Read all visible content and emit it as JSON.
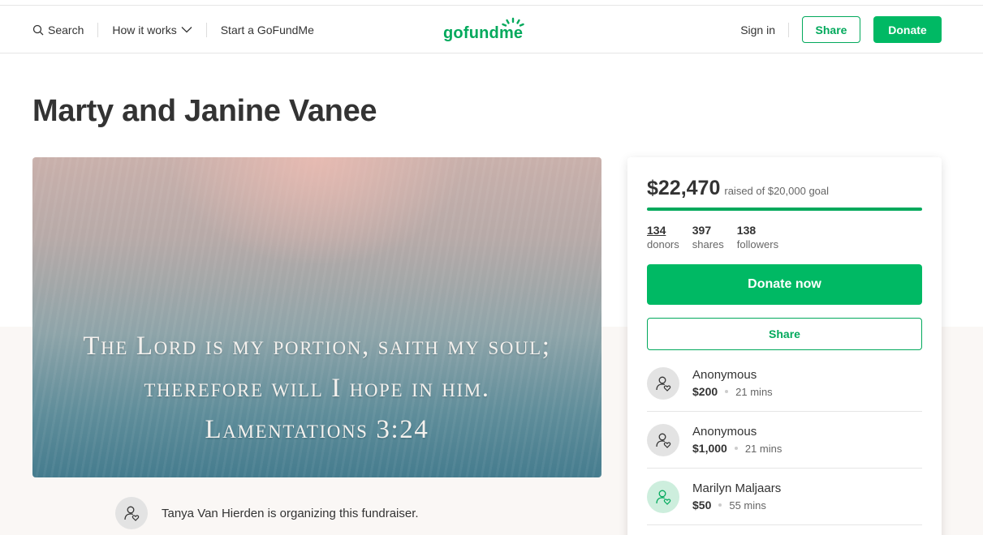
{
  "header": {
    "search_label": "Search",
    "how_it_works_label": "How it works",
    "start_label": "Start a GoFundMe",
    "logo_text": "gofundme",
    "sign_in_label": "Sign in",
    "share_label": "Share",
    "donate_label": "Donate"
  },
  "campaign": {
    "title": "Marty and Janine Vanee",
    "image_quote": {
      "line1": "The Lord is my portion, saith my soul;",
      "line2": "therefore will I hope in him.",
      "line3": "Lamentations 3:24"
    },
    "organizer_text": "Tanya Van Hierden is organizing this fundraiser."
  },
  "card": {
    "raised_amount": "$22,470",
    "goal_text": "raised of $20,000 goal",
    "progress_fraction": 1.0,
    "stats": [
      {
        "value": "134",
        "label": "donors"
      },
      {
        "value": "397",
        "label": "shares"
      },
      {
        "value": "138",
        "label": "followers"
      }
    ],
    "donate_now_label": "Donate now",
    "share_label": "Share",
    "donations": [
      {
        "name": "Anonymous",
        "amount": "$200",
        "time": "21 mins"
      },
      {
        "name": "Anonymous",
        "amount": "$1,000",
        "time": "21 mins"
      },
      {
        "name": "Marilyn Maljaars",
        "amount": "$50",
        "time": "55 mins"
      }
    ]
  },
  "colors": {
    "brand_green": "#02a95c",
    "button_green": "#00b964",
    "text": "#333333",
    "muted": "#666666"
  },
  "icons": {
    "search": "search-icon",
    "chevron": "chevron-down-icon",
    "donor": "user-heart-icon",
    "logo": "gofundme-logo-icon"
  }
}
